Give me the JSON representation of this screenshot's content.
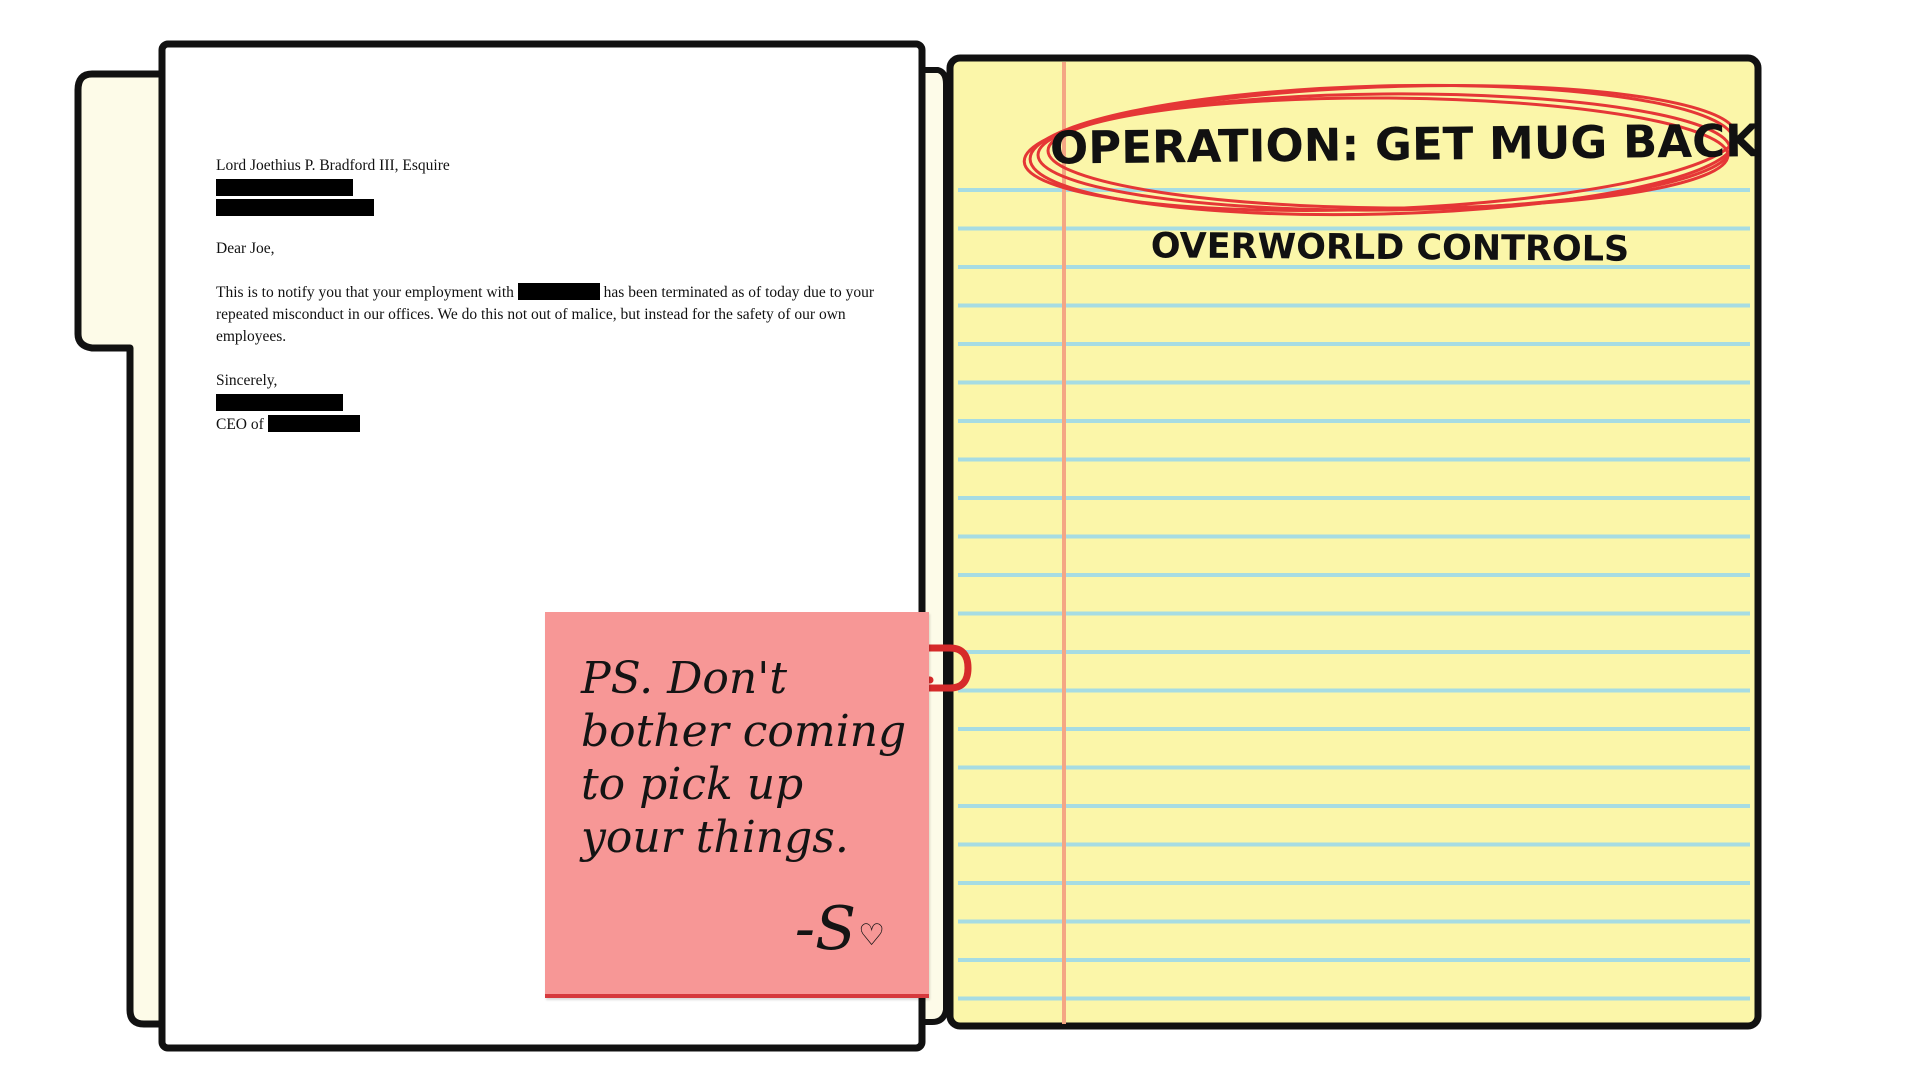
{
  "letter": {
    "recipient": "Lord Joethius P. Bradford III, Esquire",
    "greeting": "Dear Joe,",
    "body_part1": "This is to notify you that your employment with",
    "body_part2": "has been terminated as of today due to your repeated misconduct in our offices. We do this not out of malice, but instead for the safety of our own employees.",
    "closing": "Sincerely,",
    "ceo_prefix": "CEO of"
  },
  "sticky_note": {
    "lines": [
      "PS.  Don't",
      "bother coming",
      "to pick up",
      "your things."
    ],
    "signature": "-S",
    "heart_glyph": "♡",
    "color": "#f79796"
  },
  "legal_pad": {
    "title": "OPERATION: GET MUG BACK",
    "subtitle": "OVERWORLD CONTROLS",
    "paper_color": "#fbf6a9",
    "rule_color": "#a6dce3",
    "margin_color": "#f4a684",
    "circle_color": "#e53636"
  },
  "folder": {
    "tab_color": "#fdfbe8",
    "outline_color": "#111111"
  }
}
